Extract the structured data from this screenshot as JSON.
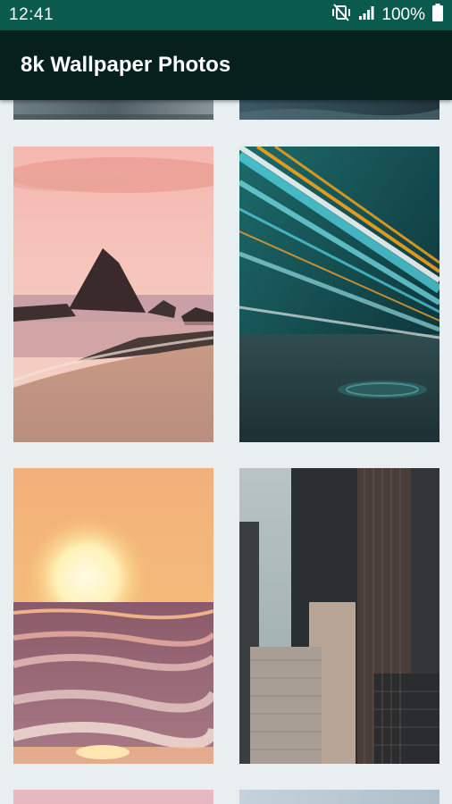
{
  "status_bar": {
    "time": "12:41",
    "battery": "100%",
    "icons": [
      "mute-vibrate-icon",
      "signal-icon",
      "battery-icon"
    ]
  },
  "app_bar": {
    "title": "8k Wallpaper Photos"
  },
  "colors": {
    "status_bar": "#0b5a4e",
    "app_bar": "#06201d",
    "background": "#e9eef0"
  },
  "wallpapers": [
    {
      "name": "partial-top-left"
    },
    {
      "name": "partial-top-right"
    },
    {
      "name": "beach-rock-sunset"
    },
    {
      "name": "light-trails-tunnel"
    },
    {
      "name": "ocean-sunset"
    },
    {
      "name": "city-skyscrapers"
    },
    {
      "name": "partial-bottom-left"
    },
    {
      "name": "partial-bottom-right"
    }
  ]
}
